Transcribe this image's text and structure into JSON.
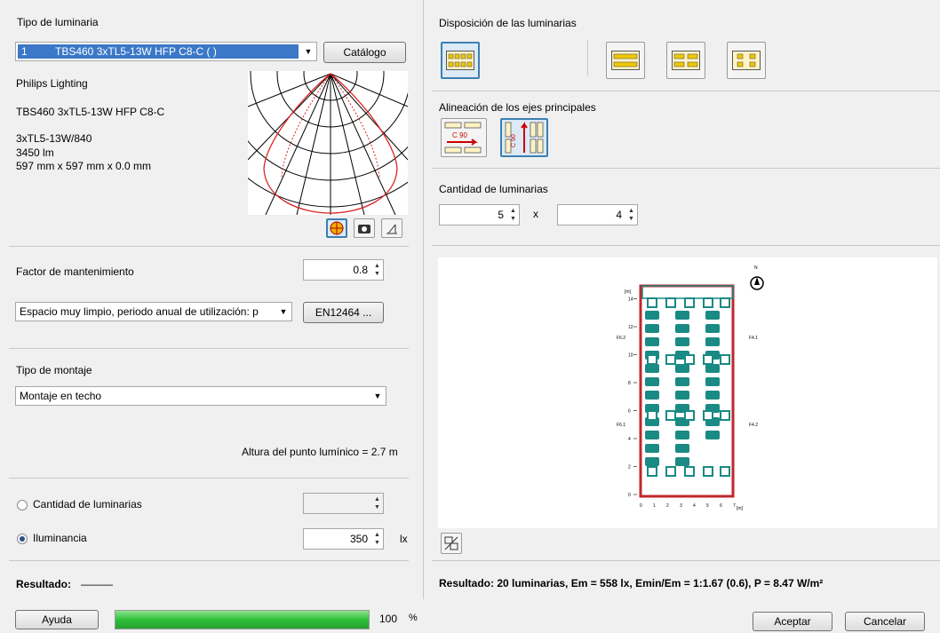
{
  "left": {
    "luminaire_type_label": "Tipo de luminaria",
    "luminaire_select": {
      "index": "1",
      "value": "TBS460 3xTL5-13W HFP C8-C ( )"
    },
    "catalog_button": "Catálogo",
    "manufacturer": "Philips Lighting",
    "model": "TBS460 3xTL5-13W HFP C8-C",
    "lamp": "3xTL5-13W/840",
    "flux": "3450 lm",
    "dimensions": "597 mm x 597 mm x 0.0 mm",
    "maintenance_label": "Factor de mantenimiento",
    "maintenance_value": "0.8",
    "environment_select": "Espacio muy limpio, periodo anual de utilización: p",
    "standard_button": "EN12464 ...",
    "mounting_label": "Tipo de montaje",
    "mounting_select": "Montaje en techo",
    "height_text": "Altura del punto lumínico = 2.7 m",
    "radio_quantity_label": "Cantidad de luminarias",
    "radio_quantity_value": "",
    "radio_illuminance_label": "Iluminancia",
    "illuminance_value": "350",
    "illuminance_unit": "lx",
    "result_label": "Resultado:",
    "result_value": "———"
  },
  "right": {
    "arrangement_label": "Disposición de las luminarias",
    "alignment_label": "Alineación de los ejes principales",
    "alignment_icon1_text": "C 90",
    "alignment_icon2_text": "C 90",
    "quantity_label": "Cantidad de luminarias",
    "qty_x": "5",
    "qty_times": "x",
    "qty_y": "4",
    "plan": {
      "north": "N",
      "y_unit": "[m]",
      "x_unit": "[m]",
      "y_ticks": [
        "0",
        "2",
        "4",
        "6",
        "8",
        "10",
        "12",
        "14"
      ],
      "x_ticks": [
        "0",
        "1",
        "2",
        "3",
        "4",
        "5",
        "6",
        "7"
      ],
      "wall_labels": [
        "F6.2",
        "F6.1",
        "F4.1",
        "F4.2"
      ]
    },
    "result_text": "Resultado: 20 luminarias, Em = 558 lx, Emin/Em = 1:1.67 (0.6), P = 8.47 W/m²"
  },
  "bottom": {
    "help_button": "Ayuda",
    "progress_value": "100",
    "progress_unit": "%",
    "progress_fraction": 1.0,
    "accept_button": "Aceptar",
    "cancel_button": "Cancelar"
  },
  "colors": {
    "selection": "#3b78c8",
    "luminaire": "#1a8a84",
    "progress": "#2fbf3b",
    "room_border": "#c0272d"
  }
}
